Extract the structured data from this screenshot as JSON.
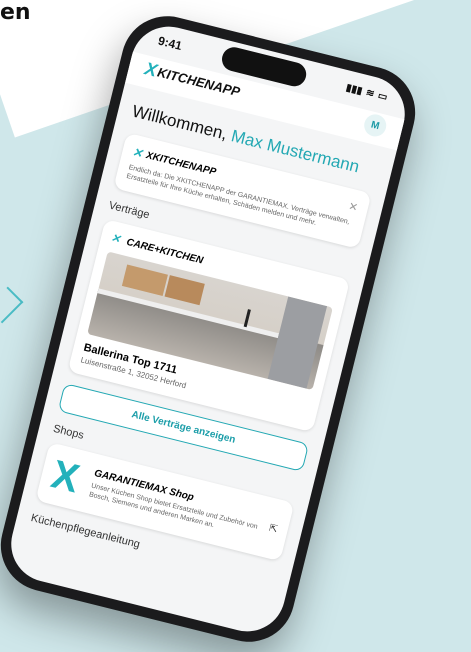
{
  "background": {
    "heading_fragment": "en"
  },
  "status_bar": {
    "time": "9:41",
    "signal": "▮▮▮",
    "wifi": "≋",
    "battery": "▭"
  },
  "header": {
    "logo_x": "X",
    "logo_text": "KITCHENAPP",
    "avatar_initial": "M"
  },
  "welcome": {
    "prefix": "Willkommen, ",
    "name": "Max Mustermann"
  },
  "info_card": {
    "brand": "XKITCHENAPP",
    "text": "Endlich da: Die XKITCHENAPP der GARANTIEMAX. Verträge verwalten, Ersatzteile für Ihre Küche erhalten, Schäden melden und mehr.",
    "close_label": "✕"
  },
  "contracts": {
    "section_title": "Verträge",
    "brand": "CARE+KITCHEN",
    "title": "Ballerina Top 1711",
    "address": "Luisenstraße 1, 32052 Herford",
    "all_button": "Alle Verträge anzeigen"
  },
  "shops": {
    "section_title": "Shops",
    "title": "GARANTIEMAX Shop",
    "description": "Unser Küchen Shop bietet Ersatzteile und Zubehör von Bosch, Siemens und anderen Marken an.",
    "external_icon": "⇱"
  },
  "footer": {
    "section_title": "Küchenpflegeanleitung"
  },
  "colors": {
    "accent": "#23a8b3",
    "background": "#cfe7ea"
  }
}
